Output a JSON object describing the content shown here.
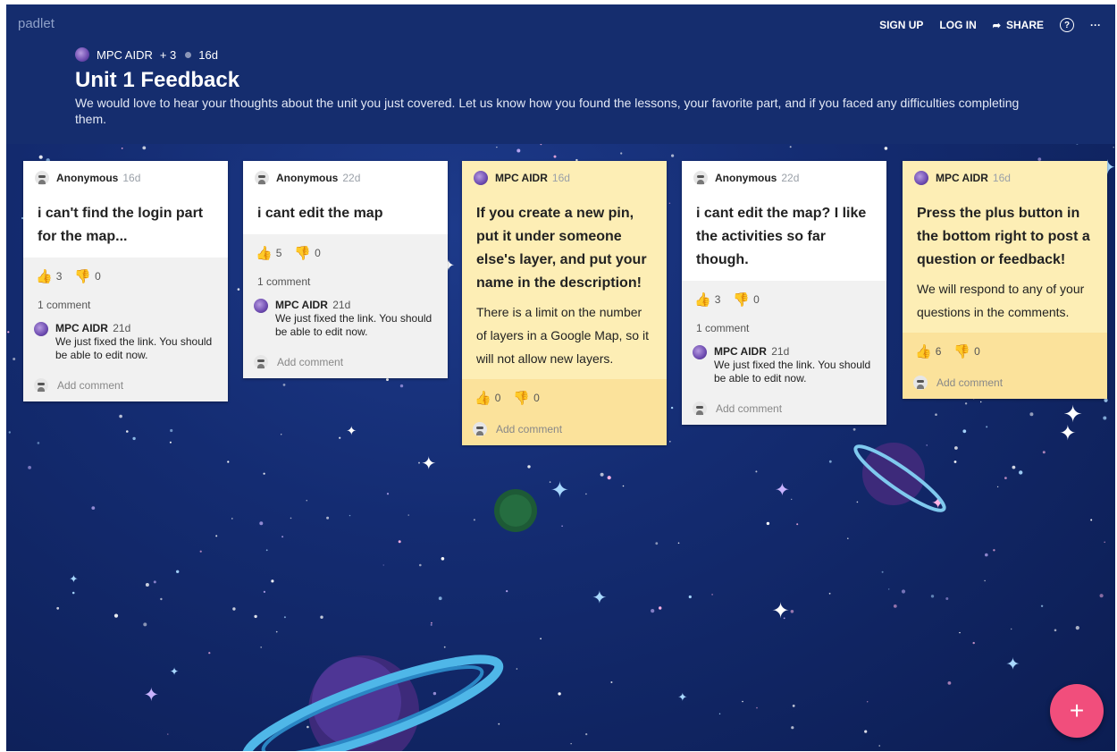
{
  "header": {
    "logo": "padlet",
    "nav": {
      "sign_up": "SIGN UP",
      "log_in": "LOG IN",
      "share": "SHARE",
      "help": "?",
      "more": "···"
    },
    "meta": {
      "owner": "MPC AIDR",
      "collaborators": "+ 3",
      "age": "16d"
    },
    "title": "Unit 1 Feedback",
    "description": "We would love to hear your thoughts about the unit you just covered. Let us know how you found the lessons, your favorite part, and if you faced any difficulties completing them."
  },
  "cards": [
    {
      "author": "Anonymous",
      "age": "16d",
      "subject": "i can't find the login part for the map...",
      "body": "",
      "likes": "3",
      "dislikes": "0",
      "comment_count": "1 comment",
      "comment": {
        "author": "MPC AIDR",
        "age": "21d",
        "text": "We just fixed the link. You should be able to edit now."
      },
      "add_comment": "Add comment"
    },
    {
      "author": "Anonymous",
      "age": "22d",
      "subject": "i cant edit the map",
      "body": "",
      "likes": "5",
      "dislikes": "0",
      "comment_count": "1 comment",
      "comment": {
        "author": "MPC AIDR",
        "age": "21d",
        "text": "We just fixed the link. You should be able to edit now."
      },
      "add_comment": "Add comment"
    },
    {
      "author": "MPC AIDR",
      "age": "16d",
      "subject": "If you create a new pin, put it under someone else's layer, and put your name in the description!",
      "body": "There is a limit on the number of layers in a Google Map, so it will not allow new layers.",
      "likes": "0",
      "dislikes": "0",
      "add_comment": "Add comment"
    },
    {
      "author": "Anonymous",
      "age": "22d",
      "subject": "i cant edit the map? I like the activities so far though.",
      "body": "",
      "likes": "3",
      "dislikes": "0",
      "comment_count": "1 comment",
      "comment": {
        "author": "MPC AIDR",
        "age": "21d",
        "text": "We just fixed the link. You should be able to edit now."
      },
      "add_comment": "Add comment"
    },
    {
      "author": "MPC AIDR",
      "age": "16d",
      "subject": "Press the plus button in the bottom right to post a question or feedback!",
      "body": "We will respond to any of your questions in the comments.",
      "likes": "6",
      "dislikes": "0",
      "add_comment": "Add comment"
    }
  ],
  "fab": {
    "label": "+"
  },
  "colors": {
    "header_bg": "#152d6e",
    "space_bg": "#142c72",
    "card_white": "#ffffff",
    "card_yellow": "#fdeeb5",
    "fab": "#f14e7c"
  }
}
